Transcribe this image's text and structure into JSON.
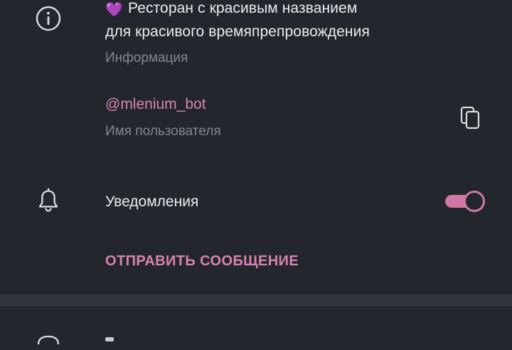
{
  "bio": {
    "emoji": "💜",
    "line1": "Ресторан с красивым названием",
    "line2": "для красивого времяпрепровождения",
    "label": "Информация"
  },
  "username": {
    "value": "@mlenium_bot",
    "label": "Имя пользователя"
  },
  "notifications": {
    "label": "Уведомления",
    "enabled": true
  },
  "actions": {
    "send_message": "ОТПРАВИТЬ СООБЩЕНИЕ"
  },
  "colors": {
    "background": "#23262c",
    "accent": "#d784b3",
    "toggle_accent": "#cf78a6",
    "secondary_text": "#83878e",
    "divider": "#31363d"
  },
  "icons": {
    "info": "info-icon",
    "bell": "bell-icon",
    "copy": "copy-icon"
  }
}
